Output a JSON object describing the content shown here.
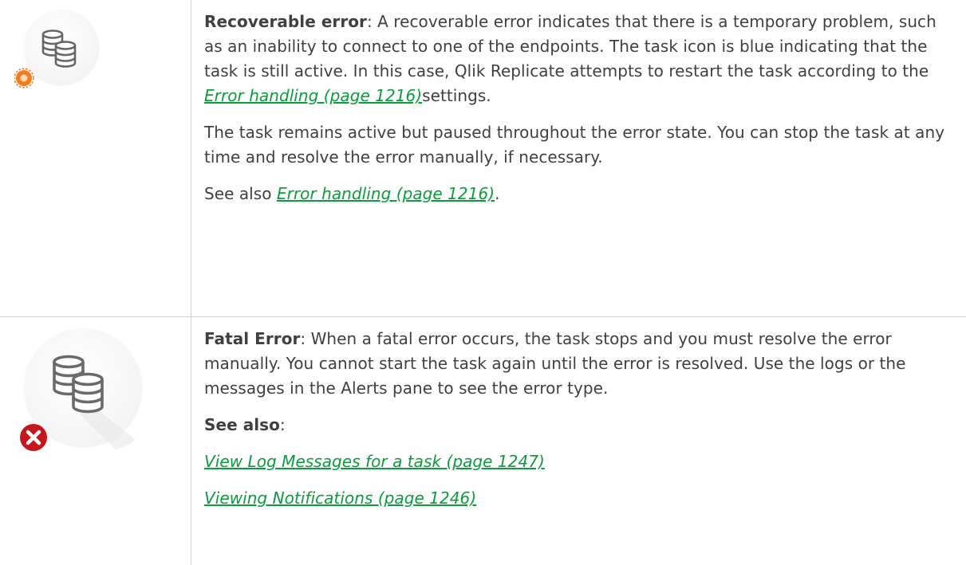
{
  "rows": [
    {
      "icon": "database-recoverable-error-icon",
      "status_color": "#f47c20",
      "paragraphs": {
        "p1_bold": "Recoverable error",
        "p1_text_a": ": A recoverable error indicates that there is a temporary problem, such as an inability to connect to one of the endpoints. The task icon is blue indicating that the task is still active. In this case, Qlik Replicate attempts to restart the task according to the ",
        "p1_link": "Error handling (page 1216)",
        "p1_text_b": "settings.",
        "p2_text": "The task remains active but paused throughout the error state. You can stop the task at any time and resolve the error manually, if necessary.",
        "p3_text_a": "See also ",
        "p3_link": "Error handling (page 1216)",
        "p3_text_b": "."
      }
    },
    {
      "icon": "database-fatal-error-icon",
      "status_color": "#c4161c",
      "paragraphs": {
        "p1_bold": "Fatal Error",
        "p1_text": ": When a fatal error occurs, the task stops and you must resolve the error manually. You cannot start the task again until the error is resolved. Use the logs or the messages in the Alerts pane to see the error type.",
        "p2_bold": "See also",
        "p2_text": ":",
        "link_1": "View Log Messages for a task (page 1247)",
        "link_2": "Viewing Notifications (page 1246)"
      }
    }
  ],
  "colors": {
    "link": "#0c9c3c",
    "text": "#404040",
    "border": "#d0d0d0"
  }
}
